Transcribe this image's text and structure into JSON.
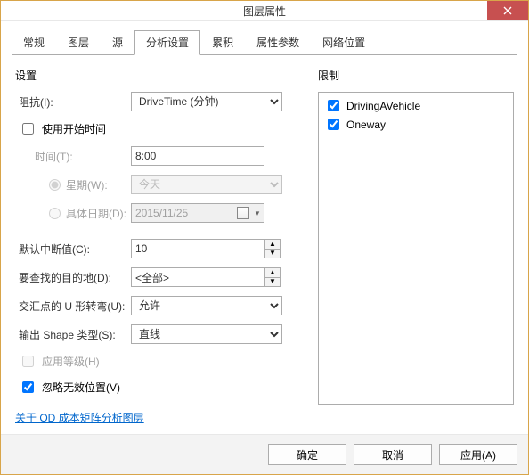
{
  "title": "图层属性",
  "tabs": [
    "常规",
    "图层",
    "源",
    "分析设置",
    "累积",
    "属性参数",
    "网络位置"
  ],
  "active_tab_index": 3,
  "settings": {
    "section": "设置",
    "impedance_label": "阻抗(I):",
    "impedance_value": "DriveTime (分钟)",
    "use_start_time_label": "使用开始时间",
    "time_label": "时间(T):",
    "time_value": "8:00",
    "dow_label": "星期(W):",
    "dow_value": "今天",
    "specific_date_label": "具体日期(D):",
    "specific_date_value": "2015/11/25",
    "default_break_label": "默认中断值(C):",
    "default_break_value": "10",
    "dest_label": "要查找的目的地(D):",
    "dest_value": "<全部>",
    "uturn_label": "交汇点的 U 形转弯(U):",
    "uturn_value": "允许",
    "shape_label": "输出 Shape 类型(S):",
    "shape_value": "直线",
    "hierarchy_label": "应用等级(H)",
    "ignore_invalid_label": "忽略无效位置(V)"
  },
  "restrictions": {
    "section": "限制",
    "items": [
      {
        "label": "DrivingAVehicle",
        "checked": true
      },
      {
        "label": "Oneway",
        "checked": true
      }
    ]
  },
  "help_link": "关于 OD 成本矩阵分析图层",
  "buttons": {
    "ok": "确定",
    "cancel": "取消",
    "apply": "应用(A)"
  }
}
